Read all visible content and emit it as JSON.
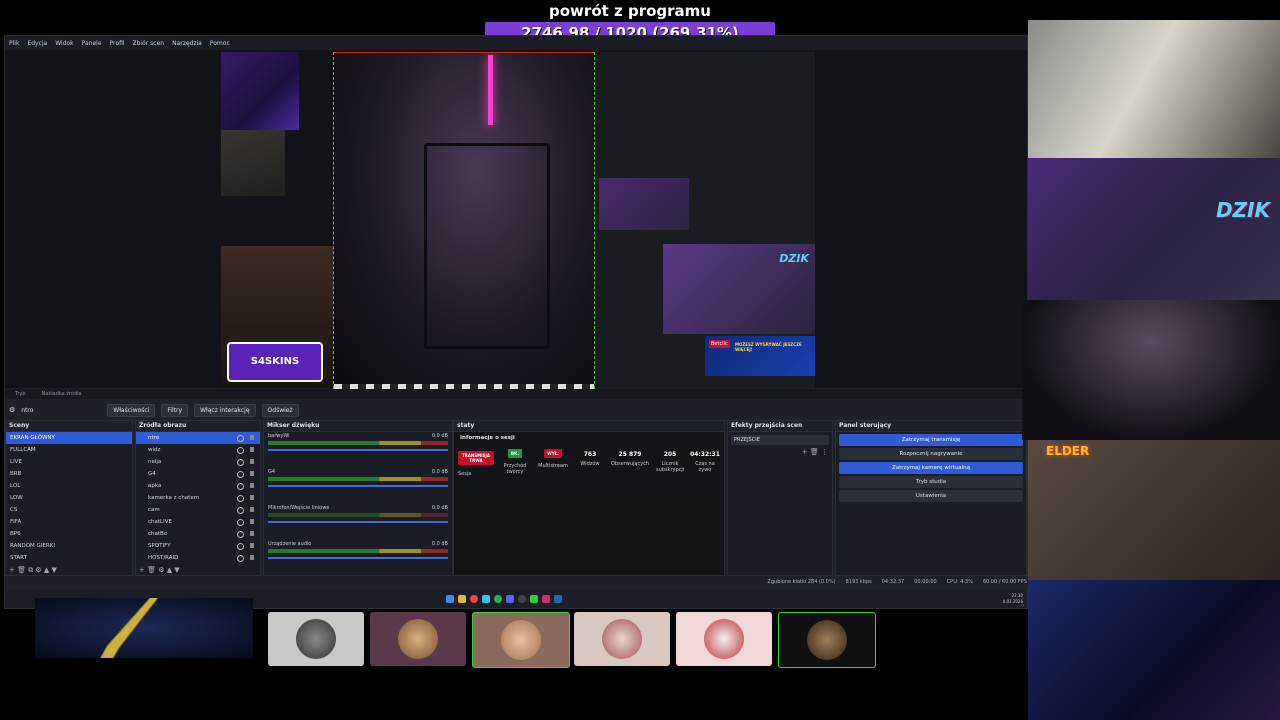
{
  "overlay": {
    "title": "powrót z programu",
    "progress_text": "2746.98 / 1020 (269.31%)",
    "progress_fraction": 1.0
  },
  "obs": {
    "menu": [
      "Plik",
      "Edycja",
      "Widok",
      "Panele",
      "Profil",
      "Zbiór scen",
      "Narzędzia",
      "Pomoc"
    ],
    "preview_tabs": [
      "Tryb",
      "Nakładka źródła"
    ],
    "toolbar": {
      "current_source": "ntro",
      "properties": "Właściwości",
      "filters": "Filtry",
      "interact": "Włącz interakcję",
      "refresh": "Odśwież"
    },
    "scenes": {
      "title": "Sceny",
      "items": [
        "EKRAN GŁÓWNY",
        "FULLCAM",
        "LIVE",
        "BRB",
        "LOL",
        "LOW",
        "CS",
        "FIFA",
        "BP6",
        "RANDOM GIERKI",
        "START"
      ],
      "selected": 0
    },
    "sources": {
      "title": "Źródła obrazu",
      "items": [
        "ntro",
        "widz",
        "nelja",
        "G4",
        "apka",
        "kamerka z chatem",
        "cam",
        "chatLIVE",
        "chatBo",
        "SPOTIFY",
        "HOST/RAID"
      ],
      "selected": 0
    },
    "mixer": {
      "title": "Mikser dźwięku",
      "channels": [
        {
          "name": "barwyWi",
          "db": "0.0 dB"
        },
        {
          "name": "G4",
          "db": "0.0 dB"
        },
        {
          "name": "Mikrofon/Wejście liniowe",
          "db": "0.0 dB"
        },
        {
          "name": "Urządzenie audio",
          "db": "0.0 dB"
        }
      ]
    },
    "stats": {
      "title": "staty",
      "session_title": "Informacje o sesji",
      "badge_stream": "TRANSMISJA TRWA",
      "badge_on": "WŁ.",
      "badge_off": "WYŁ.",
      "label_session": "Sesja",
      "label_creator": "Przychód twórcy",
      "label_multistream": "Multistream",
      "viewers_value": "763",
      "viewers_label": "Widzów",
      "followers_value": "25 879",
      "followers_label": "Obserwujących",
      "subs_value": "205",
      "subs_label": "Licznik subskrypcji",
      "time_value": "04:32:31",
      "time_label": "Czas na żywo"
    },
    "transitions": {
      "title": "Efekty przejścia scen",
      "selected": "PRZEJŚCIE"
    },
    "controls": {
      "title": "Panel sterujący",
      "buttons": [
        "Zatrzymaj transmisję",
        "Rozpocznij nagrywanie",
        "Zatrzymaj kamerę wirtualną",
        "Tryb studia",
        "Ustawienia"
      ]
    },
    "statusbar": {
      "dropped": "Zgubione klatki 284 (0.0%)",
      "bitrate": "8193 kbps",
      "live_time": "04:32:37",
      "rec_time": "00:00:00",
      "cpu": "CPU: 4.3%",
      "fps": "60.00 / 60.00 FPS"
    },
    "taskbar": {
      "clock": "23:30",
      "date": "4.02.2026"
    }
  },
  "preview": {
    "logo_text": "S4SKINS",
    "dzik_text": "DZIK",
    "promo_brand": "Betclic",
    "promo_text": "MOŻESZ WYGRYWAĆ JESZCZE WIĘCEJ!"
  },
  "webcams": {
    "elder_sign": "ELDER"
  }
}
